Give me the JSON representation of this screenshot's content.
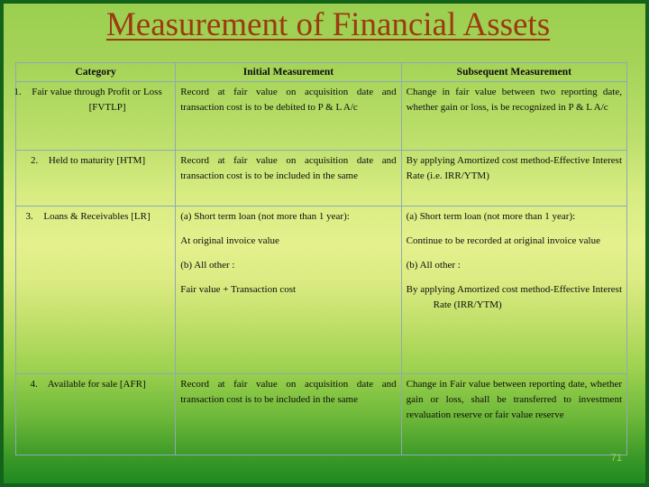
{
  "slide": {
    "title": "Measurement of Financial Assets",
    "title_color": "#9C3A10",
    "background_top_color": "#9BCF50",
    "background_mid_color": "#E4F08D",
    "background_bottom_color": "#1E8921",
    "border_color": "#14631A",
    "page_number": "71"
  },
  "table": {
    "border_color": "#8FA8B8",
    "headers": {
      "category": "Category",
      "initial": "Initial Measurement",
      "subsequent": "Subsequent Measurement"
    },
    "rows": [
      {
        "number": "1.",
        "category": "Fair value through Profit or Loss [FVTLP]",
        "initial": [
          "Record at fair value on acquisition date and transaction cost is to be debited to P & L A/c"
        ],
        "subsequent": [
          "Change in fair value between two reporting date, whether gain or loss, is be recognized in P & L A/c"
        ]
      },
      {
        "number": "2.",
        "category": "Held to maturity [HTM]",
        "initial": [
          "Record at fair value on acquisition date and transaction cost is to be included in the same"
        ],
        "subsequent": [
          "By applying Amortized cost method-Effective Interest Rate (i.e. IRR/YTM)"
        ]
      },
      {
        "number": "3.",
        "category": "Loans & Receivables [LR]",
        "initial_blocks": {
          "a_label": "(a)   Short term loan (not more than 1 year):",
          "a_text": "At original invoice value",
          "b_label": "(b)        All other :",
          "b_text": "Fair value + Transaction cost"
        },
        "subsequent_blocks": {
          "a_label": "(a)   Short term loan (not more than 1 year):",
          "a_text": "Continue to be recorded at original invoice value",
          "b_label": "(b)  All other :",
          "b_text": "By applying Amortized cost method-Effective Interest Rate (IRR/YTM)"
        }
      },
      {
        "number": "4.",
        "category": "Available for sale [AFR]",
        "initial": [
          "Record at fair value on acquisition date and transaction cost is to be included in the same"
        ],
        "subsequent": [
          "Change in Fair value between reporting date, whether gain or loss, shall be transferred to investment revaluation reserve or fair value reserve"
        ]
      }
    ]
  }
}
